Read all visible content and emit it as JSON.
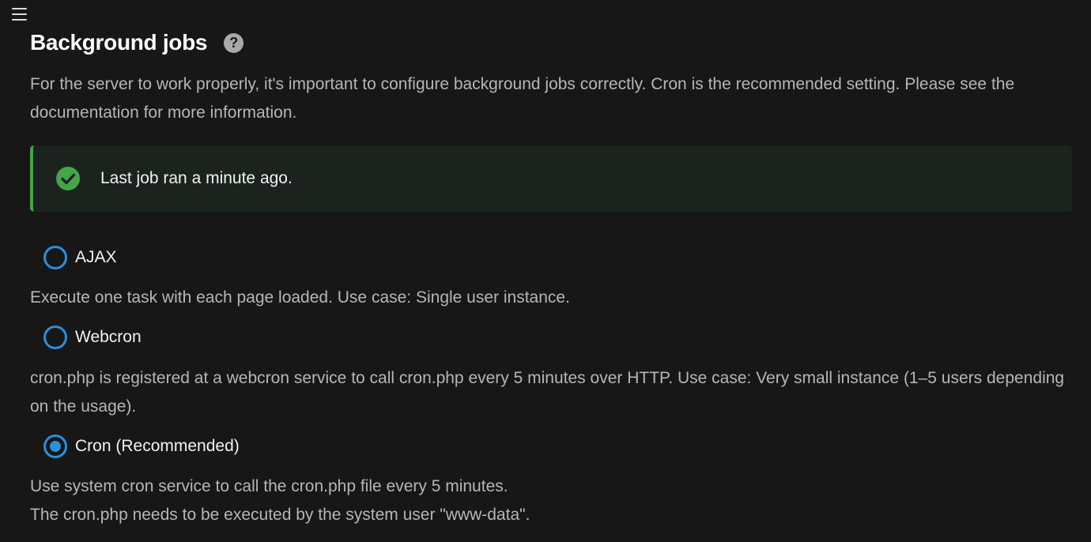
{
  "header": {
    "menu_icon": "hamburger-menu-icon"
  },
  "section": {
    "title": "Background jobs",
    "help_icon": "help-question-icon",
    "help_glyph": "?",
    "intro": "For the server to work properly, it's important to configure background jobs correctly. Cron is the recommended setting. Please see the documentation for more information."
  },
  "status": {
    "icon": "check-circle-icon",
    "text": "Last job ran a minute ago.",
    "color": "#46a44a"
  },
  "options": [
    {
      "label": "AJAX",
      "checked": false,
      "description": "Execute one task with each page loaded. Use case: Single user instance."
    },
    {
      "label": "Webcron",
      "checked": false,
      "description": "cron.php is registered at a webcron service to call cron.php every 5 minutes over HTTP. Use case: Very small instance (1–5 users depending on the usage)."
    },
    {
      "label": "Cron (Recommended)",
      "checked": true,
      "description_lines": [
        "Use system cron service to call the cron.php file every 5 minutes.",
        "The cron.php needs to be executed by the system user \"www-data\"."
      ]
    }
  ],
  "colors": {
    "background": "#171717",
    "accent": "#2d8ed9",
    "success": "#46a44a"
  }
}
